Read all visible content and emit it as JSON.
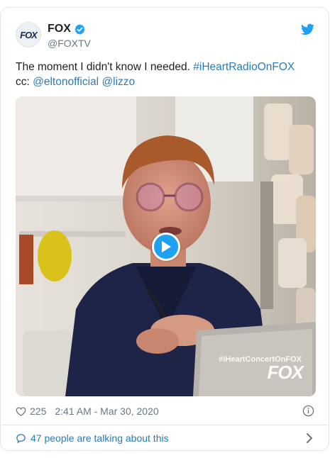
{
  "author": {
    "display_name": "FOX",
    "handle": "@FOXTV",
    "avatar_text": "FOX",
    "verified": true
  },
  "tweet": {
    "text_plain": "The moment I didn't know I needed. ",
    "hashtag": "#iHeartRadioOnFOX",
    "cc_label": "cc: ",
    "mention_1": "@eltonofficial",
    "mention_2": "@lizzo"
  },
  "media": {
    "type": "video",
    "watermark_tag": "#iHeartConcertOnFOX",
    "watermark_logo": "FOX",
    "play_icon": "play-icon"
  },
  "meta": {
    "like_count": "225",
    "timestamp": "2:41 AM - Mar 30, 2020"
  },
  "conversation": {
    "label": "47 people are talking about this"
  },
  "colors": {
    "link": "#2b7bb9",
    "accent": "#1da1f2",
    "muted": "#697882",
    "border": "#e1e8ed"
  }
}
